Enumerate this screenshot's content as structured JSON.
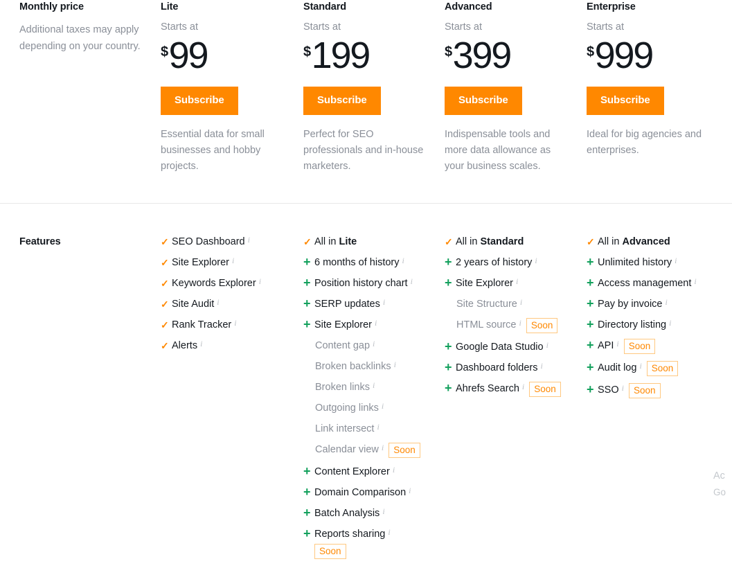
{
  "colors": {
    "accent_orange": "#ff8800",
    "plus_green": "#12a05c",
    "muted_text": "#8a8f98",
    "body_text": "#14191f",
    "divider": "#e8e8e8",
    "badge_border": "#ffc880"
  },
  "price_section": {
    "label": "Monthly price",
    "note": "Additional taxes may apply depending on your country.",
    "plans": [
      {
        "name": "Lite",
        "starts_at": "Starts at",
        "currency": "$",
        "amount": "99",
        "cta": "Subscribe",
        "description": "Essential data for small businesses and hobby projects."
      },
      {
        "name": "Standard",
        "starts_at": "Starts at",
        "currency": "$",
        "amount": "199",
        "cta": "Subscribe",
        "description": "Perfect for SEO professionals and in-house marketers."
      },
      {
        "name": "Advanced",
        "starts_at": "Starts at",
        "currency": "$",
        "amount": "399",
        "cta": "Subscribe",
        "description": "Indispensable tools and more data allowance as your business scales."
      },
      {
        "name": "Enterprise",
        "starts_at": "Starts at",
        "currency": "$",
        "amount": "999",
        "cta": "Subscribe",
        "description": "Ideal for big agencies and enterprises."
      }
    ]
  },
  "features_section": {
    "label": "Features",
    "icons": {
      "check": "✓",
      "plus": "+",
      "info": "i"
    },
    "badge_soon": "Soon",
    "columns": [
      {
        "plan": "Lite",
        "items": [
          {
            "mark": "check",
            "text": "SEO Dashboard",
            "info": true
          },
          {
            "mark": "check",
            "text": "Site Explorer",
            "info": true
          },
          {
            "mark": "check",
            "text": "Keywords Explorer",
            "info": true
          },
          {
            "mark": "check",
            "text": "Site Audit",
            "info": true
          },
          {
            "mark": "check",
            "text": "Rank Tracker",
            "info": true
          },
          {
            "mark": "check",
            "text": "Alerts",
            "info": true
          }
        ]
      },
      {
        "plan": "Standard",
        "items": [
          {
            "mark": "check",
            "text": "All in ",
            "bold": "Lite",
            "info": false
          },
          {
            "mark": "plus",
            "text": "6 months of history",
            "info": true
          },
          {
            "mark": "plus",
            "text": "Position history chart",
            "info": true
          },
          {
            "mark": "plus",
            "text": "SERP updates",
            "info": true
          },
          {
            "mark": "plus",
            "text": "Site Explorer",
            "info": true
          },
          {
            "mark": "none",
            "sub": true,
            "text": "Content gap",
            "info": true
          },
          {
            "mark": "none",
            "sub": true,
            "text": "Broken backlinks",
            "info": true
          },
          {
            "mark": "none",
            "sub": true,
            "text": "Broken links",
            "info": true
          },
          {
            "mark": "none",
            "sub": true,
            "text": "Outgoing links",
            "info": true
          },
          {
            "mark": "none",
            "sub": true,
            "text": "Link intersect",
            "info": true
          },
          {
            "mark": "none",
            "sub": true,
            "text": "Calendar view",
            "info": true,
            "badge": "Soon"
          },
          {
            "mark": "plus",
            "text": "Content Explorer",
            "info": true
          },
          {
            "mark": "plus",
            "text": "Domain Comparison",
            "info": true
          },
          {
            "mark": "plus",
            "text": "Batch Analysis",
            "info": true
          },
          {
            "mark": "plus",
            "text": "Reports sharing",
            "info": true,
            "badge": "Soon",
            "badge_wrap": true
          }
        ]
      },
      {
        "plan": "Advanced",
        "items": [
          {
            "mark": "check",
            "text": "All in ",
            "bold": "Standard",
            "info": false
          },
          {
            "mark": "plus",
            "text": "2 years of history",
            "info": true
          },
          {
            "mark": "plus",
            "text": "Site Explorer",
            "info": true
          },
          {
            "mark": "none",
            "sub": true,
            "text": "Site Structure",
            "info": true
          },
          {
            "mark": "none",
            "sub": true,
            "text": "HTML source",
            "info": true,
            "badge": "Soon"
          },
          {
            "mark": "plus",
            "text": "Google Data Studio",
            "info": true
          },
          {
            "mark": "plus",
            "text": "Dashboard folders",
            "info": true
          },
          {
            "mark": "plus",
            "text": "Ahrefs Search",
            "info": true,
            "badge": "Soon"
          }
        ]
      },
      {
        "plan": "Enterprise",
        "items": [
          {
            "mark": "check",
            "text": "All in ",
            "bold": "Advanced",
            "info": false
          },
          {
            "mark": "plus",
            "text": "Unlimited history",
            "info": true
          },
          {
            "mark": "plus",
            "text": "Access management",
            "info": true
          },
          {
            "mark": "plus",
            "text": "Pay by invoice",
            "info": true
          },
          {
            "mark": "plus",
            "text": "Directory listing",
            "info": true
          },
          {
            "mark": "plus",
            "text": "API",
            "info": true,
            "badge": "Soon"
          },
          {
            "mark": "plus",
            "text": "Audit log",
            "info": true,
            "badge": "Soon"
          },
          {
            "mark": "plus",
            "text": "SSO",
            "info": true,
            "badge": "Soon"
          }
        ]
      }
    ]
  },
  "corner_widget": {
    "line1": "Ac",
    "line2": "Go"
  }
}
